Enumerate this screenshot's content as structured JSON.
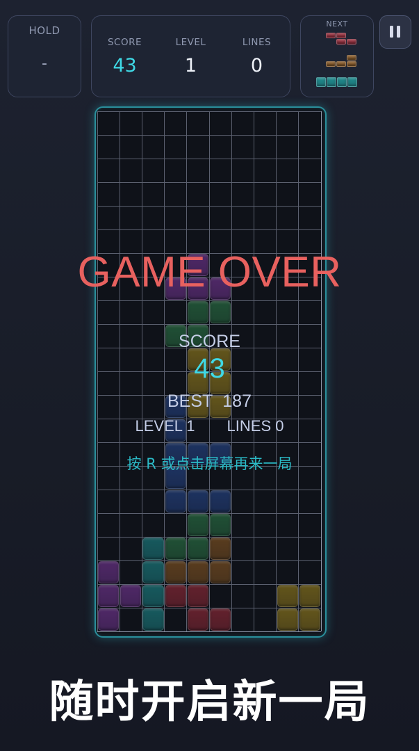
{
  "hud": {
    "hold_label": "HOLD",
    "hold_value": "-",
    "score_label": "SCORE",
    "score_value": "43",
    "level_label": "LEVEL",
    "level_value": "1",
    "lines_label": "LINES",
    "lines_value": "0",
    "next_label": "NEXT"
  },
  "game_over": {
    "title": "GAME OVER",
    "score_label": "SCORE",
    "score_value": "43",
    "best_label": "BEST",
    "best_value": "187",
    "level_text": "LEVEL 1",
    "lines_text": "LINES 0",
    "restart_hint": "按 R 或点击屏幕再来一局"
  },
  "caption": "随时开启新一局",
  "colors": {
    "purple": "#7a3a9a",
    "green": "#2f7a4a",
    "yellow": "#9a8220",
    "blue": "#2a4a8e",
    "teal": "#1f8a8c",
    "orange": "#8a5a25",
    "red": "#9a2e3c",
    "accent": "#3fd9e6",
    "gameover": "#e8615f"
  },
  "board": {
    "cols": 10,
    "rows": 22,
    "cells": [
      [
        7,
        4,
        "purple"
      ],
      [
        8,
        3,
        "purple"
      ],
      [
        8,
        4,
        "purple"
      ],
      [
        8,
        5,
        "purple"
      ],
      [
        9,
        4,
        "green"
      ],
      [
        9,
        5,
        "green"
      ],
      [
        10,
        3,
        "green"
      ],
      [
        10,
        4,
        "green"
      ],
      [
        11,
        4,
        "yellow"
      ],
      [
        11,
        5,
        "yellow"
      ],
      [
        12,
        4,
        "yellow"
      ],
      [
        12,
        5,
        "yellow"
      ],
      [
        13,
        3,
        "blue"
      ],
      [
        13,
        4,
        "yellow"
      ],
      [
        13,
        5,
        "yellow"
      ],
      [
        14,
        3,
        "blue"
      ],
      [
        15,
        3,
        "blue"
      ],
      [
        15,
        4,
        "blue"
      ],
      [
        15,
        5,
        "blue"
      ],
      [
        16,
        3,
        "blue"
      ],
      [
        17,
        3,
        "blue"
      ],
      [
        17,
        4,
        "blue"
      ],
      [
        17,
        5,
        "blue"
      ],
      [
        18,
        4,
        "green"
      ],
      [
        18,
        5,
        "green"
      ],
      [
        19,
        2,
        "teal"
      ],
      [
        19,
        3,
        "green"
      ],
      [
        19,
        4,
        "green"
      ],
      [
        19,
        5,
        "orange"
      ],
      [
        20,
        0,
        "purple"
      ],
      [
        20,
        2,
        "teal"
      ],
      [
        20,
        3,
        "orange"
      ],
      [
        20,
        4,
        "orange"
      ],
      [
        20,
        5,
        "orange"
      ],
      [
        21,
        0,
        "purple"
      ],
      [
        21,
        1,
        "purple"
      ],
      [
        21,
        2,
        "teal"
      ],
      [
        21,
        3,
        "red"
      ],
      [
        21,
        4,
        "red"
      ],
      [
        21,
        8,
        "yellow"
      ],
      [
        21,
        9,
        "yellow"
      ],
      [
        22,
        0,
        "purple"
      ],
      [
        22,
        2,
        "teal"
      ],
      [
        22,
        4,
        "red"
      ],
      [
        22,
        5,
        "red"
      ],
      [
        22,
        8,
        "yellow"
      ],
      [
        22,
        9,
        "yellow"
      ]
    ]
  },
  "next_piece": {
    "z_color": "red",
    "l_color": "orange",
    "i_color": "teal"
  }
}
